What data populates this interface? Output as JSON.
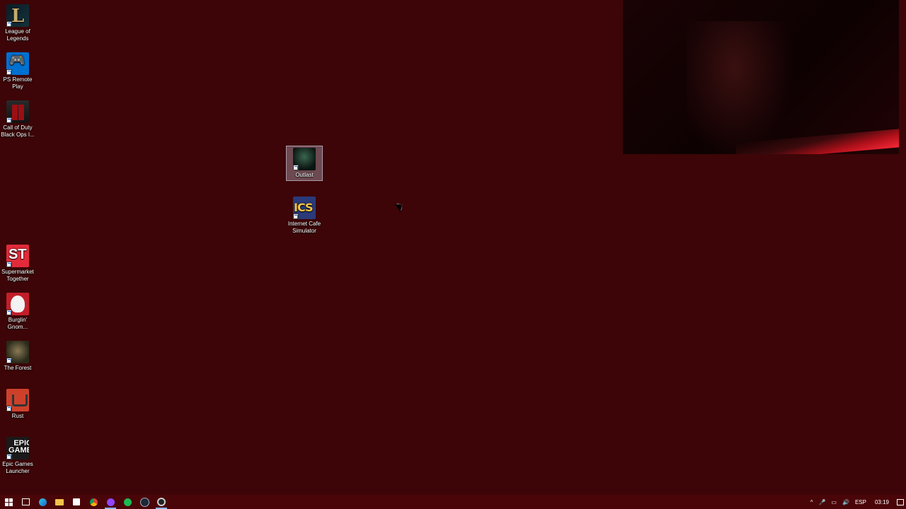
{
  "desktop": {
    "icons_left": [
      {
        "label": "League of Legends",
        "icon": "league-of-legends-icon"
      },
      {
        "label": "PS Remote Play",
        "icon": "ps-remote-play-icon"
      },
      {
        "label": "Call of Duty Black Ops I...",
        "icon": "call-of-duty-icon"
      },
      {
        "label": "Supermarket Together",
        "icon": "supermarket-together-icon"
      },
      {
        "label": "Burglin' Gnom...",
        "icon": "burglin-gnomes-icon"
      },
      {
        "label": "The Forest",
        "icon": "the-forest-icon"
      },
      {
        "label": "Rust",
        "icon": "rust-icon"
      },
      {
        "label": "Epic Games Launcher",
        "icon": "epic-games-icon"
      }
    ],
    "icons_center": [
      {
        "label": "Outlast",
        "icon": "outlast-icon",
        "selected": true
      },
      {
        "label": "Internet Cafe Simulator",
        "icon": "internet-cafe-simulator-icon"
      }
    ],
    "st_glyph": "ST",
    "ics_glyph": "ICS",
    "epic_glyph": "EPIC GAMES"
  },
  "taskbar": {
    "tray": {
      "language": "ESP",
      "time": "03:19"
    }
  },
  "colors": {
    "desktop_background": "#3d0507",
    "taskbar": "#4a0508"
  }
}
